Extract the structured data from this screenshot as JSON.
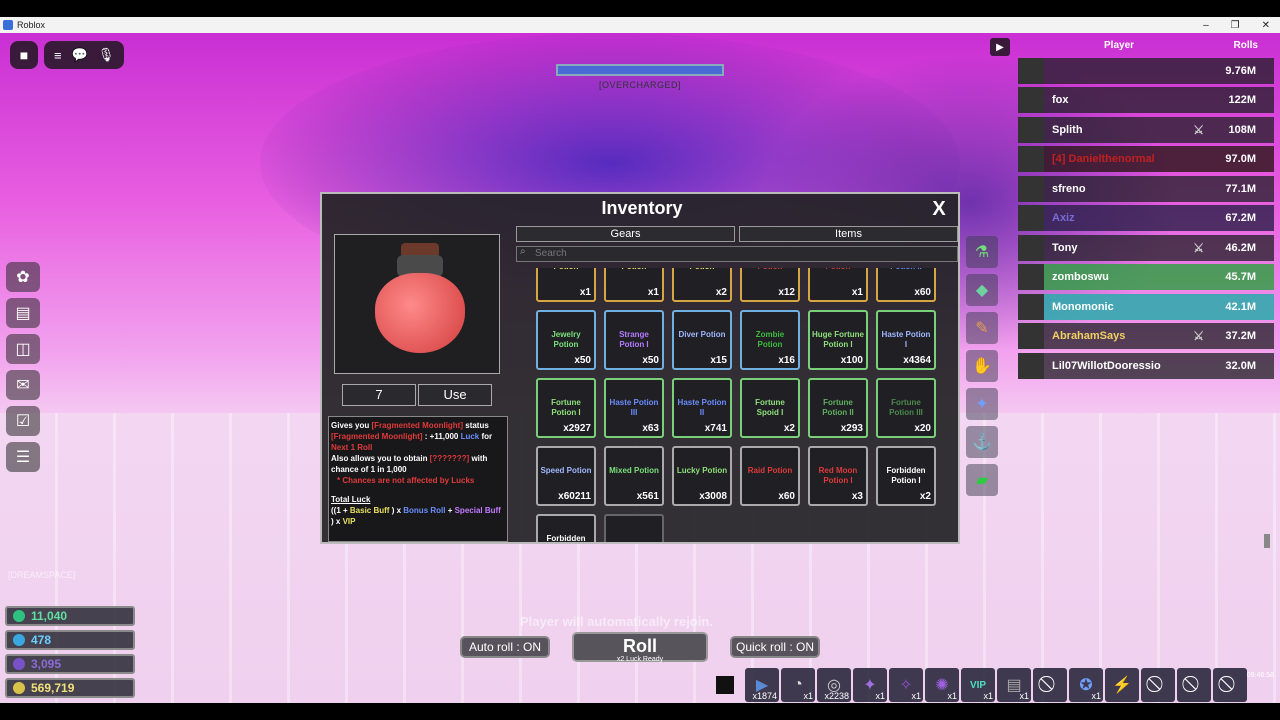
{
  "window": {
    "title": "Roblox",
    "controls": [
      "–",
      "❐",
      "✕"
    ]
  },
  "topbar": {
    "menu_icon": "≡",
    "chat_icon": "💬",
    "mic_icon": "🎙"
  },
  "overcharge": {
    "label": "[OVERCHARGED]",
    "fill": 1.0
  },
  "dream_label": "[DREAMSPACE]",
  "stats": [
    {
      "value": "11,040",
      "color": "#5fe0a0",
      "icon_color": "#2ec27e"
    },
    {
      "value": "478",
      "color": "#6ad0ff",
      "icon_color": "#3aa8e0"
    },
    {
      "value": "3,095",
      "color": "#8c6bd6",
      "icon_color": "#7a52c7"
    },
    {
      "value": "569,719",
      "color": "#f0e27a",
      "icon_color": "#d9c24a"
    }
  ],
  "inventory": {
    "title": "Inventory",
    "close": "X",
    "quantity": "7",
    "use_label": "Use",
    "tabs": [
      "Gears",
      "Items"
    ],
    "search_placeholder": "Search",
    "description": {
      "l1a": "Gives you ",
      "l1b": "[Fragmented Moonlight]",
      "l1c": " status",
      "l2a": "[Fragmented Moonlight]",
      "l2b": " : +11,000 ",
      "l2c": "Luck",
      "l2d": " for",
      "l3": "Next 1 Roll",
      "l4a": "Also allows you to obtain ",
      "l4b": "[???????]",
      "l4c": " with",
      "l5": "chance of 1 in 1,000",
      "l6": "* Chances are not affected by Lucks",
      "l7": "Total Luck",
      "l8a": "((1 + ",
      "l8b": "Basic Buff",
      "l8c": " ) x ",
      "l8d": "Bonus Roll",
      "l8e": " + ",
      "l8f": "Special Buff",
      "l9a": " ) x ",
      "l9b": "VIP"
    },
    "items": [
      {
        "name": "Potion",
        "count": "x1",
        "color": "#e9e060",
        "border": "#d8a545"
      },
      {
        "name": "Potion",
        "count": "x1",
        "color": "#e9e060",
        "border": "#d8a545"
      },
      {
        "name": "Potion",
        "count": "x2",
        "color": "#e9e060",
        "border": "#d8a545"
      },
      {
        "name": "Potion",
        "count": "x12",
        "color": "#e03a3a",
        "border": "#d8a545"
      },
      {
        "name": "Potion",
        "count": "x1",
        "color": "#e03a3a",
        "border": "#d8a545"
      },
      {
        "name": "Potion II",
        "count": "x60",
        "color": "#6b8dff",
        "border": "#d8a545"
      },
      {
        "name": "Jewelry Potion",
        "count": "x50",
        "color": "#7ae07a",
        "border": "#6fb0e0"
      },
      {
        "name": "Strange Potion I",
        "count": "x50",
        "color": "#b57bff",
        "border": "#6fb0e0"
      },
      {
        "name": "Diver Potion",
        "count": "x15",
        "color": "#9fb8ff",
        "border": "#6fb0e0"
      },
      {
        "name": "Zombie Potion",
        "count": "x16",
        "color": "#3dbb3d",
        "border": "#6fb0e0"
      },
      {
        "name": "Huge Fortune Potion I",
        "count": "x100",
        "color": "#8fe07a",
        "border": "#7ad07a"
      },
      {
        "name": "Haste Potion I",
        "count": "x4364",
        "color": "#9fb8ff",
        "border": "#7ad07a"
      },
      {
        "name": "Fortune Potion I",
        "count": "x2927",
        "color": "#8fe07a",
        "border": "#7ad07a"
      },
      {
        "name": "Haste Potion III",
        "count": "x63",
        "color": "#6b8dff",
        "border": "#7ad07a"
      },
      {
        "name": "Haste Potion II",
        "count": "x741",
        "color": "#6b8dff",
        "border": "#7ad07a"
      },
      {
        "name": "Fortune Spoid I",
        "count": "x2",
        "color": "#8fe07a",
        "border": "#7ad07a"
      },
      {
        "name": "Fortune Potion II",
        "count": "x293",
        "color": "#5fb05f",
        "border": "#7ad07a"
      },
      {
        "name": "Fortune Potion III",
        "count": "x20",
        "color": "#4a8a4a",
        "border": "#7ad07a"
      },
      {
        "name": "Speed Potion",
        "count": "x60211",
        "color": "#9fb8ff",
        "border": "#aaaaaa"
      },
      {
        "name": "Mixed Potion",
        "count": "x561",
        "color": "#7ae07a",
        "border": "#aaaaaa"
      },
      {
        "name": "Lucky Potion",
        "count": "x3008",
        "color": "#8fe07a",
        "border": "#aaaaaa"
      },
      {
        "name": "Raid Potion",
        "count": "x60",
        "color": "#e03a3a",
        "border": "#aaaaaa"
      },
      {
        "name": "Red Moon Potion I",
        "count": "x3",
        "color": "#e03a3a",
        "border": "#aaaaaa"
      },
      {
        "name": "Forbidden Potion I",
        "count": "x2",
        "color": "#ffffff",
        "border": "#aaaaaa"
      },
      {
        "name": "Forbidden Potion II",
        "count": "",
        "color": "#ffffff",
        "border": "#aaaaaa"
      },
      {
        "name": "",
        "count": "",
        "color": "#ffffff",
        "border": "#666666"
      }
    ]
  },
  "leaderboard": {
    "header_player": "Player",
    "header_rolls": "Rolls",
    "rows": [
      {
        "name": "",
        "rolls": "9.76M",
        "name_color": "#ffffff",
        "bg": "rgba(30,30,35,.75)",
        "x": false
      },
      {
        "name": "fox",
        "rolls": "122M",
        "name_color": "#ffffff",
        "bg": "rgba(30,30,35,.75)",
        "x": false
      },
      {
        "name": "Splith",
        "rolls": "108M",
        "name_color": "#ffffff",
        "bg": "rgba(30,30,35,.75)",
        "x": true
      },
      {
        "name": "[4] Danielthenormal",
        "rolls": "97.0M",
        "name_color": "#c02020",
        "bg": "rgba(40,20,20,.8)",
        "x": false
      },
      {
        "name": "sfreno",
        "rolls": "77.1M",
        "name_color": "#ffffff",
        "bg": "rgba(30,30,35,.75)",
        "x": false
      },
      {
        "name": "Axiz",
        "rolls": "67.2M",
        "name_color": "#7a6bd6",
        "bg": "rgba(40,30,70,.8)",
        "x": false
      },
      {
        "name": "Tony",
        "rolls": "46.2M",
        "name_color": "#ffffff",
        "bg": "rgba(30,30,35,.75)",
        "x": true
      },
      {
        "name": "zomboswu",
        "rolls": "45.7M",
        "name_color": "#ffffff",
        "bg": "rgba(40,160,60,.8)",
        "x": false
      },
      {
        "name": "Monomonic",
        "rolls": "42.1M",
        "name_color": "#ffffff",
        "bg": "rgba(40,170,170,.85)",
        "x": false
      },
      {
        "name": "AbrahamSays",
        "rolls": "37.2M",
        "name_color": "#f0d060",
        "bg": "rgba(30,30,35,.75)",
        "x": true
      },
      {
        "name": "Lil07WillotDooressio",
        "rolls": "32.0M",
        "name_color": "#ffffff",
        "bg": "rgba(30,30,35,.75)",
        "x": false
      }
    ]
  },
  "bottom": {
    "rejoin": "Player will automatically rejoin.",
    "auto_roll": "Auto roll : ON",
    "roll": "Roll",
    "roll_sub": "x2 Luck Ready",
    "quick_roll": "Quick roll : ON",
    "time": "09:46:58"
  },
  "hotbar": [
    {
      "icon": "▶",
      "count": "x1874",
      "color": "#5a8ad6"
    },
    {
      "icon": "◔",
      "count": "x1",
      "color": "#ddd"
    },
    {
      "icon": "◎",
      "count": "x2238",
      "color": "#ccc"
    },
    {
      "icon": "✦",
      "count": "x1",
      "color": "#a070e0"
    },
    {
      "icon": "✧",
      "count": "x1",
      "color": "#9050d0"
    },
    {
      "icon": "✺",
      "count": "x1",
      "color": "#a060e0"
    },
    {
      "icon": "VIP",
      "count": "x1",
      "color": "#4ae0c0"
    },
    {
      "icon": "▤",
      "count": "x1",
      "color": "#aaa"
    },
    {
      "icon": "⃠",
      "count": "",
      "color": "#fff"
    },
    {
      "icon": "✪",
      "count": "x1",
      "color": "#6fa0ff"
    },
    {
      "icon": "⚡",
      "count": "",
      "color": "#8fe07a"
    },
    {
      "icon": "⃠",
      "count": "",
      "color": "#fff"
    },
    {
      "icon": "⃠",
      "count": "",
      "color": "#fff"
    },
    {
      "icon": "⃠",
      "count": "",
      "color": "#fff"
    }
  ]
}
